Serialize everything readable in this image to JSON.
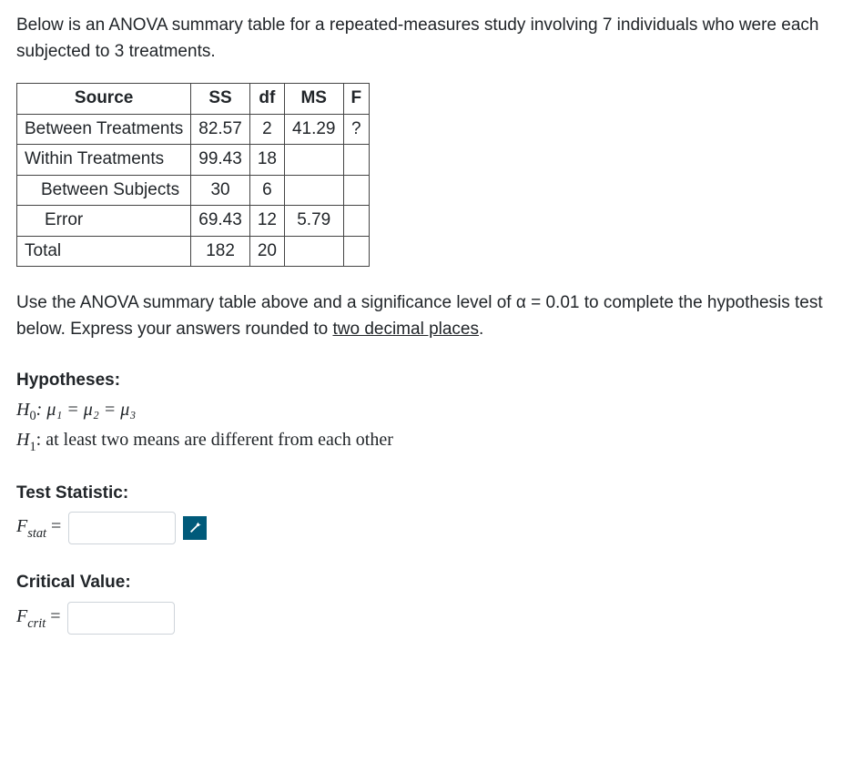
{
  "intro": "Below is an ANOVA summary table for a repeated-measures study involving 7 individuals who were each subjected to 3 treatments.",
  "table": {
    "headers": {
      "source": "Source",
      "ss": "SS",
      "df": "df",
      "ms": "MS",
      "f": "F"
    },
    "rows": [
      {
        "label": "Between Treatments",
        "ss": "82.57",
        "df": "2",
        "ms": "41.29",
        "f": "?",
        "indent": 0
      },
      {
        "label": "Within Treatments",
        "ss": "99.43",
        "df": "18",
        "ms": "",
        "f": "",
        "indent": 0
      },
      {
        "label": "Between Subjects",
        "ss": "30",
        "df": "6",
        "ms": "",
        "f": "",
        "indent": 1
      },
      {
        "label": "Error",
        "ss": "69.43",
        "df": "12",
        "ms": "5.79",
        "f": "",
        "indent": 2
      },
      {
        "label": "Total",
        "ss": "182",
        "df": "20",
        "ms": "",
        "f": "",
        "indent": 0
      }
    ]
  },
  "instructions_pre": "Use the ANOVA summary table above and a significance level of α = 0.01 to complete the hypothesis test below. Express your answers rounded to ",
  "instructions_underlined": "two decimal places",
  "instructions_post": ".",
  "hypotheses_title": "Hypotheses:",
  "h0_label": "H",
  "h0_sub": "0",
  "h0_body": ": μ₁ = μ₂ = μ₃",
  "h1_label": "H",
  "h1_sub": "1",
  "h1_body": ": at least two means are different from each other",
  "stat_title": "Test Statistic:",
  "stat_lhs_sym": "F",
  "stat_lhs_sub": "stat",
  "crit_title": "Critical Value:",
  "crit_lhs_sym": "F",
  "crit_lhs_sub": "crit",
  "equals": " = ",
  "fstat_value": "",
  "fcrit_value": ""
}
